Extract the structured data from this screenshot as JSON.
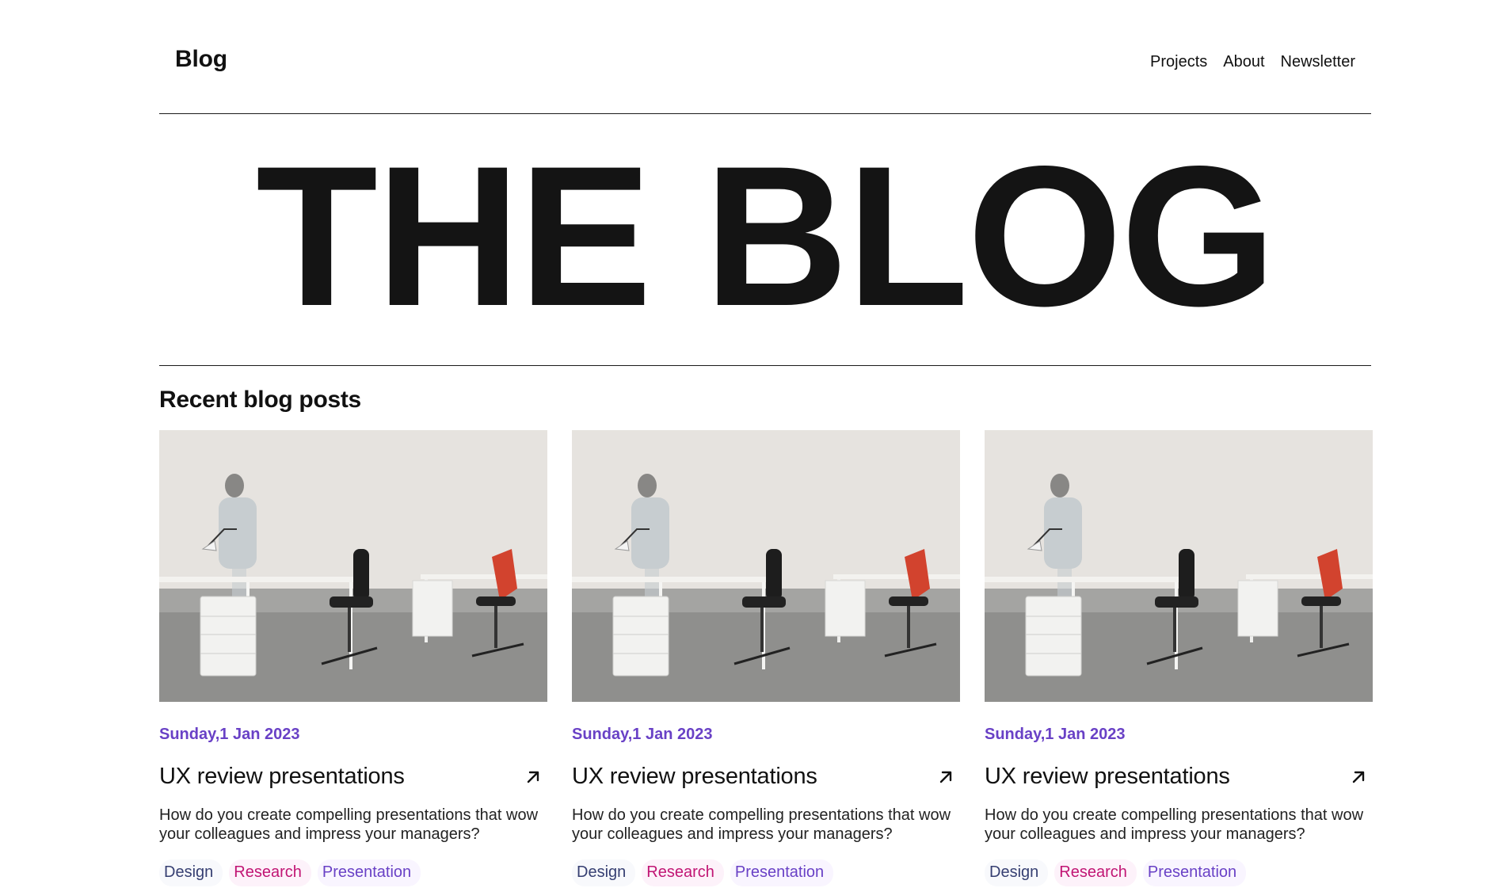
{
  "header": {
    "brand": "Blog",
    "nav": [
      "Projects",
      "About",
      "Newsletter"
    ]
  },
  "hero": {
    "title": "THE BLOG"
  },
  "section": {
    "title": "Recent blog posts"
  },
  "posts": [
    {
      "date": "Sunday,1 Jan 2023",
      "title": "UX review presentations",
      "excerpt": "How do you create compelling presentations that wow your colleagues and impress your managers?",
      "tags": [
        "Design",
        "Research",
        "Presentation"
      ]
    },
    {
      "date": "Sunday,1 Jan 2023",
      "title": "UX review presentations",
      "excerpt": "How do you create compelling presentations that wow your colleagues and impress your managers?",
      "tags": [
        "Design",
        "Research",
        "Presentation"
      ]
    },
    {
      "date": "Sunday,1 Jan 2023",
      "title": "UX review presentations",
      "excerpt": "How do you create compelling presentations that wow your colleagues and impress your managers?",
      "tags": [
        "Design",
        "Research",
        "Presentation"
      ]
    }
  ],
  "colors": {
    "date": "#6941c6",
    "tag_design": "#363f72",
    "tag_research": "#c11574",
    "tag_presentation": "#6941c6"
  },
  "icons": {
    "post_link": "arrow-up-right-icon"
  }
}
